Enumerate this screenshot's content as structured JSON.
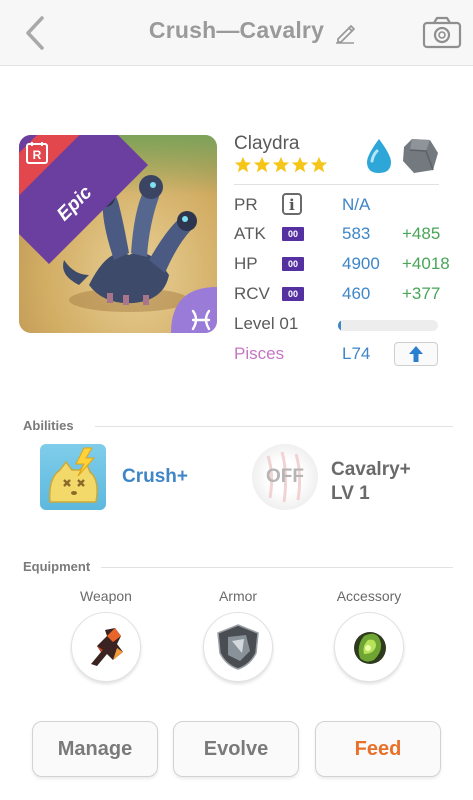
{
  "header": {
    "title": "Crush—Cavalry"
  },
  "monster": {
    "name": "Claydra",
    "rarity": "Epic",
    "rarity_badge": "R",
    "stars": 5,
    "element": "water",
    "type": "rock",
    "zodiac_sign": "pisces",
    "stats": {
      "pr": {
        "label": "PR",
        "value": "N/A"
      },
      "atk": {
        "label": "ATK",
        "badge": "00",
        "value": "583",
        "bonus": "+485"
      },
      "hp": {
        "label": "HP",
        "badge": "00",
        "value": "4900",
        "bonus": "+4018"
      },
      "rcv": {
        "label": "RCV",
        "badge": "00",
        "value": "460",
        "bonus": "+377"
      }
    },
    "level": {
      "label": "Level 01",
      "progress": 0.03
    },
    "sign": {
      "label": "Pisces",
      "value": "L74"
    }
  },
  "abilities": {
    "title": "Abilities",
    "primary": {
      "name": "Crush+"
    },
    "secondary": {
      "status": "OFF",
      "name_line1": "Cavalry+",
      "name_line2": "LV 1"
    }
  },
  "equipment": {
    "title": "Equipment",
    "slots": [
      {
        "label": "Weapon"
      },
      {
        "label": "Armor"
      },
      {
        "label": "Accessory"
      }
    ]
  },
  "actions": {
    "manage": "Manage",
    "evolve": "Evolve",
    "feed": "Feed"
  },
  "colors": {
    "accent_blue": "#3e86c7",
    "bonus_green": "#4aa558",
    "feed_orange": "#e8712a",
    "epic_red": "#e1474c",
    "rare_purple": "#6b3fa0",
    "pisces_pink": "#c676c5"
  }
}
